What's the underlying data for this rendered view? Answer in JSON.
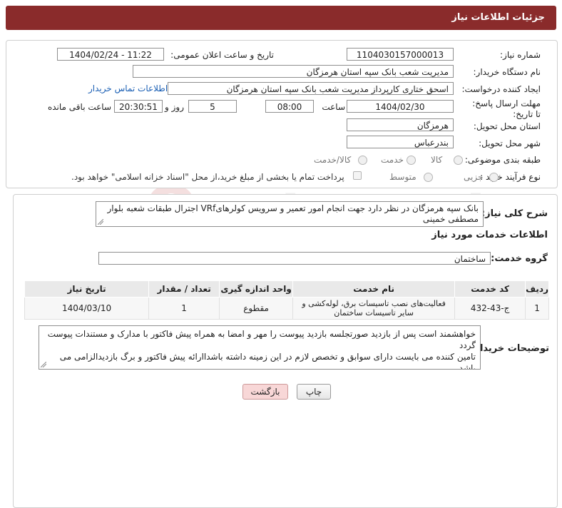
{
  "header": {
    "title": "جزئیات اطلاعات نیاز"
  },
  "info": {
    "need_number_label": "شماره نیاز:",
    "need_number": "1104030157000013",
    "announce_label": "تاریخ و ساعت اعلان عمومی:",
    "announce_value": "1404/02/24 - 11:22",
    "buyer_org_label": "نام دستگاه خریدار:",
    "buyer_org": "مدیریت شعب بانک سپه استان هرمزگان",
    "creator_label": "ایجاد کننده درخواست:",
    "creator": "اسحق ختاری کارپرداز مدیریت شعب بانک سپه استان هرمزگان",
    "contact_link": "اطلاعات تماس خریدار",
    "deadline_label": "مهلت ارسال پاسخ: تا تاریخ:",
    "deadline_date": "1404/02/30",
    "time_label": "ساعت",
    "deadline_time": "08:00",
    "days": "5",
    "days_label": "روز و",
    "remaining_time": "20:30:51",
    "remaining_label": "ساعت باقی مانده",
    "province_label": "استان محل تحویل:",
    "province": "هرمزگان",
    "city_label": "شهر محل تحویل:",
    "city": "بندرعباس",
    "category_label": "طبقه بندی موضوعی:",
    "category_options": [
      "کالا",
      "خدمت",
      "کالا/خدمت"
    ],
    "process_label": "نوع فرآیند خرید :",
    "process_options": [
      "جزیی",
      "متوسط"
    ],
    "payment_note": "پرداخت تمام یا بخشی از مبلغ خرید،از محل \"اسناد خزانه اسلامی\" خواهد بود."
  },
  "description": {
    "label": "شرح کلی نیاز:",
    "text": "بانک سپه هرمزگان در نظر دارد جهت انجام امور تعمیر و سرویس کولرهایVRf اجترال طبقات شعبه بلوار مصطفی خمینی"
  },
  "services": {
    "title": "اطلاعات خدمات مورد نیاز",
    "group_label": "گروه خدمت:",
    "group_value": "ساختمان",
    "columns": [
      "ردیف",
      "کد خدمت",
      "نام خدمت",
      "واحد اندازه گیری",
      "تعداد / مقدار",
      "تاریخ نیاز"
    ],
    "rows": [
      [
        "1",
        "ج-43-432",
        "فعالیت‌های نصب تاسیسات برق، لوله‌کشی و سایر تاسیسات ساختمان",
        "مقطوع",
        "1",
        "1404/03/10"
      ]
    ]
  },
  "buyer_notes": {
    "label": "توضیحات خریدار:",
    "line1": "خواهشمند است پس از بازدید صورتجلسه بازدید پیوست را مهر و امضا به همراه پیش فاکتور با مدارک و مستندات پیوست گردد",
    "line2": "تامین کننده می بایست دارای سوابق و تخصص لازم در این زمینه داشته باشداارائه پیش فاکتور و برگ بازدیدالزامی می باشد"
  },
  "buttons": {
    "print": "چاپ",
    "back": "بازگشت"
  },
  "watermark": {
    "text": "AriaTender.neT"
  },
  "colors": {
    "header": "#8a2b2b",
    "link": "#1a5fb4",
    "back_button": "#f8d7d7"
  }
}
